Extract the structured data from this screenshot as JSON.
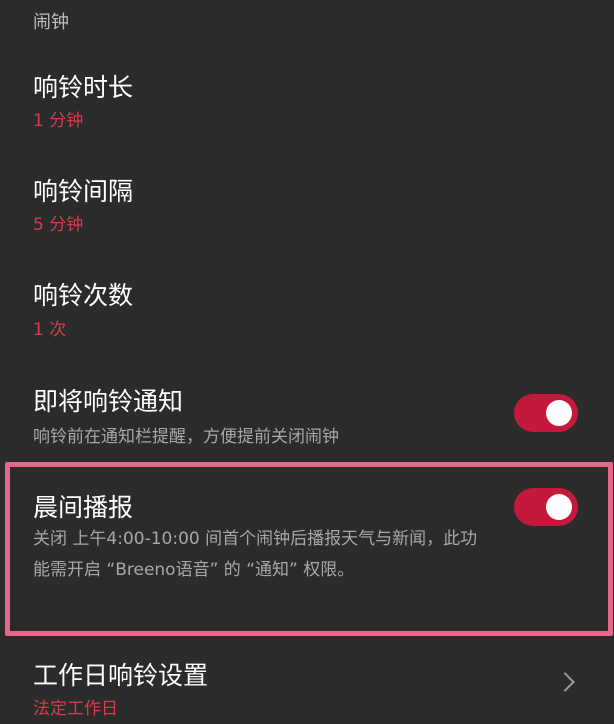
{
  "header": {
    "title": "闹钟"
  },
  "settings": {
    "ring_duration": {
      "title": "响铃时长",
      "value": "1 分钟"
    },
    "ring_interval": {
      "title": "响铃间隔",
      "value": "5 分钟"
    },
    "ring_count": {
      "title": "响铃次数",
      "value": "1 次"
    },
    "upcoming_notice": {
      "title": "即将响铃通知",
      "desc": "响铃前在通知栏提醒，方便提前关闭闹钟",
      "enabled": true
    },
    "morning_broadcast": {
      "title": "晨间播报",
      "desc": "关闭 上午4:00-10:00 间首个闹钟后播报天气与新闻，此功能需开启 “Breeno语音” 的 “通知” 权限。",
      "enabled": true
    },
    "workday_ring": {
      "title": "工作日响铃设置",
      "value": "法定工作日"
    }
  },
  "colors": {
    "background": "#2b2b2b",
    "accent": "#d93a4f",
    "toggle_on": "#c5183d",
    "highlight_border": "#e8668a"
  }
}
